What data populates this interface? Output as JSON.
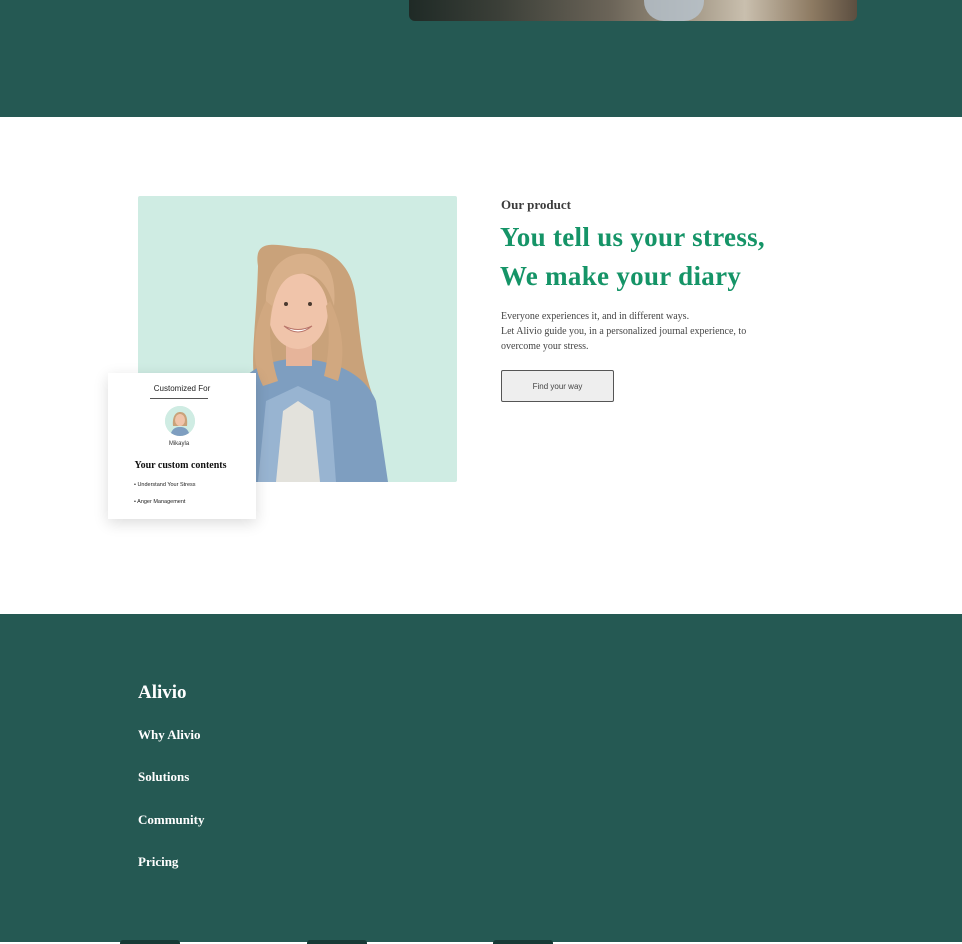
{
  "colors": {
    "band": "#255953",
    "accent": "#159467",
    "panel": "#cfece3",
    "button_bg": "#eeeeee"
  },
  "product": {
    "eyebrow": "Our product",
    "headline_line1": "You tell us your stress,",
    "headline_line2": "We make your diary",
    "body_line1": "Everyone experiences it, and in different ways.",
    "body_line2": "Let Alivio guide you, in a personalized journal experience, to",
    "body_line3": "overcome your stress.",
    "cta_label": "Find your way"
  },
  "custom_card": {
    "title": "Customized For",
    "name": "Mikayla",
    "heading": "Your custom contents",
    "items": [
      "• Understand Your Stress",
      "• Anger Management"
    ]
  },
  "footer": {
    "brand": "Alivio",
    "links": [
      "Why Alivio",
      "Solutions",
      "Community",
      "Pricing"
    ]
  }
}
